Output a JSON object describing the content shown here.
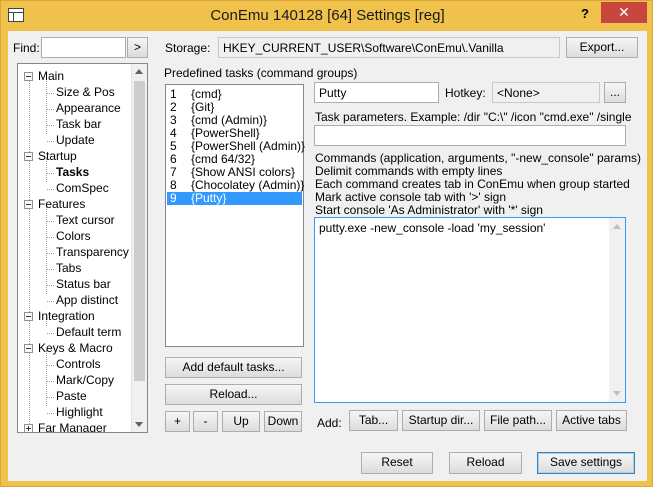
{
  "window": {
    "title": "ConEmu 140128 [64] Settings [reg]",
    "help_label": "?",
    "close_label": "✕"
  },
  "find": {
    "label": "Find:",
    "value": "",
    "go_label": ">"
  },
  "storage": {
    "label": "Storage:",
    "value": "HKEY_CURRENT_USER\\Software\\ConEmu\\.Vanilla",
    "export_label": "Export..."
  },
  "tree": {
    "items": [
      {
        "label": "Main",
        "level": 0
      },
      {
        "label": "Size & Pos",
        "level": 1
      },
      {
        "label": "Appearance",
        "level": 1
      },
      {
        "label": "Task bar",
        "level": 1
      },
      {
        "label": "Update",
        "level": 1
      },
      {
        "label": "Startup",
        "level": 0
      },
      {
        "label": "Tasks",
        "level": 1,
        "selected": true
      },
      {
        "label": "ComSpec",
        "level": 1
      },
      {
        "label": "Features",
        "level": 0
      },
      {
        "label": "Text cursor",
        "level": 1
      },
      {
        "label": "Colors",
        "level": 1
      },
      {
        "label": "Transparency",
        "level": 1
      },
      {
        "label": "Tabs",
        "level": 1
      },
      {
        "label": "Status bar",
        "level": 1
      },
      {
        "label": "App distinct",
        "level": 1
      },
      {
        "label": "Integration",
        "level": 0
      },
      {
        "label": "Default term",
        "level": 1
      },
      {
        "label": "Keys & Macro",
        "level": 0
      },
      {
        "label": "Controls",
        "level": 1
      },
      {
        "label": "Mark/Copy",
        "level": 1
      },
      {
        "label": "Paste",
        "level": 1
      },
      {
        "label": "Highlight",
        "level": 1
      },
      {
        "label": "Far Manager",
        "level": 0,
        "collapsed": true
      }
    ]
  },
  "tasks": {
    "group_label": "Predefined tasks (command groups)",
    "items": [
      {
        "num": "1",
        "name": "{cmd}"
      },
      {
        "num": "2",
        "name": "{Git}"
      },
      {
        "num": "3",
        "name": "{cmd (Admin)}"
      },
      {
        "num": "4",
        "name": "{PowerShell}"
      },
      {
        "num": "5",
        "name": "{PowerShell (Admin)}"
      },
      {
        "num": "6",
        "name": "{cmd 64/32}"
      },
      {
        "num": "7",
        "name": "{Show ANSI colors}"
      },
      {
        "num": "8",
        "name": "{Chocolatey (Admin)}"
      },
      {
        "num": "9",
        "name": "{Putty}",
        "selected": true
      }
    ],
    "add_default_label": "Add default tasks...",
    "reload_label": "Reload...",
    "plus_label": "+",
    "minus_label": "-",
    "up_label": "Up",
    "down_label": "Down"
  },
  "task_edit": {
    "name_value": "Putty",
    "hotkey_label": "Hotkey:",
    "hotkey_value": "<None>",
    "hotkey_btn_label": "...",
    "params_label": "Task parameters. Example: /dir \"C:\\\" /icon \"cmd.exe\" /single",
    "params_value": "",
    "commands_help": [
      "Commands (application, arguments, \"-new_console\" params)",
      "Delimit commands with empty lines",
      "Each command creates tab in ConEmu when group started",
      "Mark active console tab with '>' sign",
      "Start console 'As Administrator' with '*' sign"
    ],
    "commands_value": "putty.exe -new_console -load 'my_session'",
    "add_label": "Add:",
    "tab_btn": "Tab...",
    "startup_dir_btn": "Startup dir...",
    "file_path_btn": "File path...",
    "active_tabs_btn": "Active tabs"
  },
  "footer": {
    "reset_label": "Reset",
    "reload_label": "Reload",
    "save_label": "Save settings"
  }
}
